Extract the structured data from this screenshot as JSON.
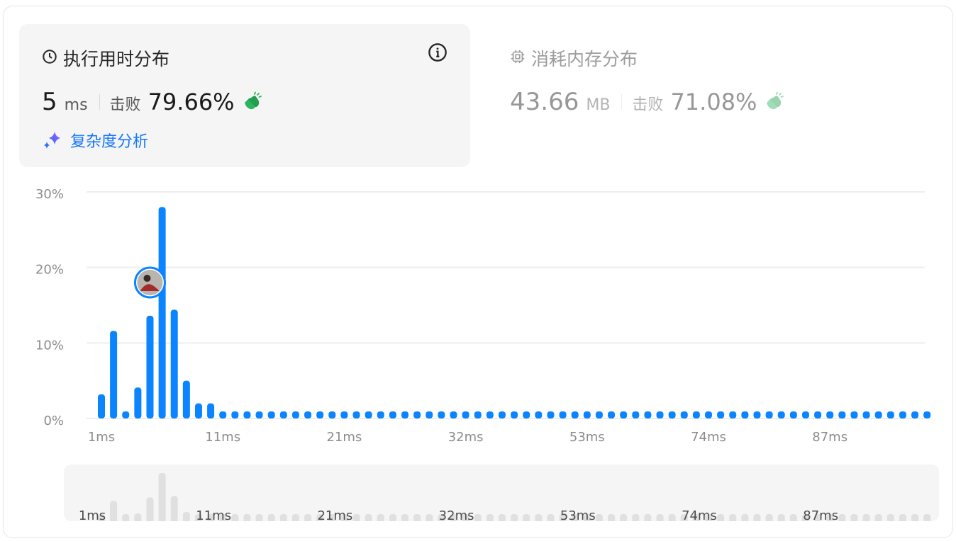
{
  "runtime": {
    "title": "执行用时分布",
    "value": "5",
    "unit": "ms",
    "beat_label": "击败",
    "beat_pct": "79.66%",
    "complexity_label": "复杂度分析"
  },
  "memory": {
    "title": "消耗内存分布",
    "value": "43.66",
    "unit": "MB",
    "beat_label": "击败",
    "beat_pct": "71.08%"
  },
  "colors": {
    "bar": "#0a84ff",
    "clap": "#2db55d",
    "mini_bar": "#e0e0e0",
    "accent": "#1677ff"
  },
  "icons": {
    "clock": "clock-icon",
    "info": "info-icon",
    "chip": "chip-icon",
    "clap": "clapping-hands-icon",
    "sparkle": "sparkle-icon"
  },
  "chart_data": {
    "type": "bar",
    "y_ticks": [
      "30%",
      "20%",
      "10%",
      "0%"
    ],
    "ylim": [
      0,
      30
    ],
    "x_tick_labels": [
      "1ms",
      "11ms",
      "21ms",
      "32ms",
      "53ms",
      "74ms",
      "87ms"
    ],
    "x_tick_index": [
      0,
      10,
      20,
      30,
      40,
      50,
      60
    ],
    "values": [
      3.2,
      11.6,
      0.8,
      4.1,
      13.6,
      28.0,
      14.4,
      5.0,
      2.0,
      2.0,
      0.7,
      0.7,
      0.7,
      0.7,
      0.7,
      0.7,
      0.7,
      0.7,
      0.7,
      0.7,
      0.7,
      0.7,
      0.7,
      0.7,
      0.7,
      0.7,
      0.7,
      0.7,
      0.7,
      0.7,
      0.7,
      0.7,
      0.7,
      0.7,
      0.7,
      0.7,
      0.7,
      0.7,
      0.7,
      0.7,
      0.7,
      0.7,
      0.7,
      0.7,
      0.7,
      0.7,
      0.7,
      0.7,
      0.7,
      0.7,
      0.7,
      0.7,
      0.7,
      0.7,
      0.7,
      0.7,
      0.7,
      0.7,
      0.7,
      0.7,
      0.7,
      0.7,
      0.7,
      0.7,
      0.7,
      0.7,
      0.7,
      0.7,
      0.7
    ],
    "current_index": 4,
    "current_value": 18.0,
    "grid": true
  }
}
